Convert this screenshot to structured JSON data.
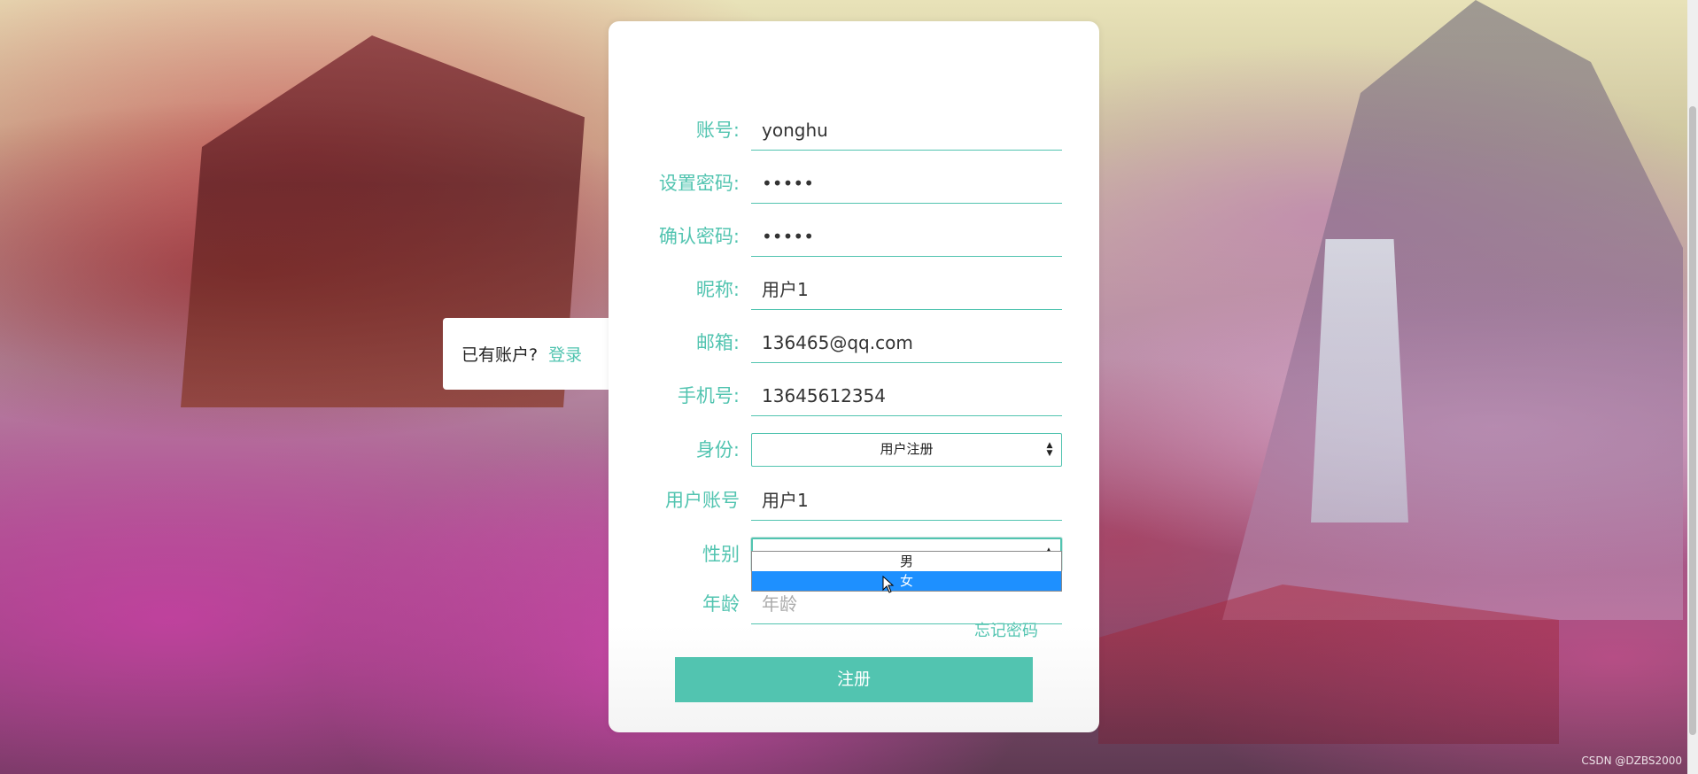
{
  "login_prompt": {
    "text": "已有账户?",
    "link": "登录"
  },
  "form": {
    "fields": [
      {
        "label": "账号:",
        "value": "yonghu"
      },
      {
        "label": "设置密码:",
        "value": "•••••"
      },
      {
        "label": "确认密码:",
        "value": "•••••"
      },
      {
        "label": "昵称:",
        "value": "用户1"
      },
      {
        "label": "邮箱:",
        "value": "136465@qq.com"
      },
      {
        "label": "手机号:",
        "value": "13645612354"
      }
    ],
    "identity": {
      "label": "身份:",
      "selected": "用户注册"
    },
    "user_account": {
      "label": "用户账号",
      "value": "用户1"
    },
    "gender": {
      "label": "性别",
      "selected": "",
      "options": [
        "男",
        "女"
      ],
      "highlighted": "女"
    },
    "age": {
      "label": "年龄",
      "placeholder": "年龄"
    },
    "forgot_password": "忘记密码",
    "submit": "注册"
  },
  "watermark": "CSDN @DZBS2000",
  "colors": {
    "accent": "#52c4b0",
    "dropdown_highlight": "#1e90ff"
  }
}
